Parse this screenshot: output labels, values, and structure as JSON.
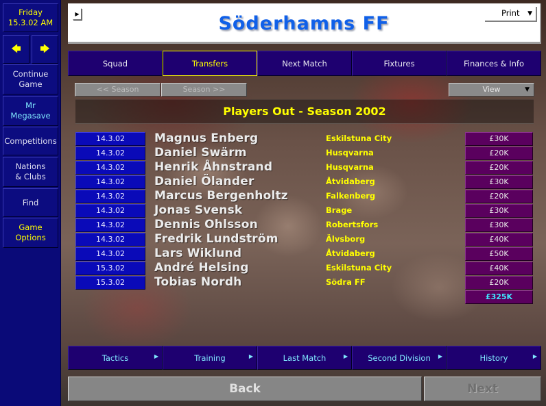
{
  "sidebar": {
    "date_day": "Friday",
    "date_value": "15.3.02 AM",
    "prev_icon": "left-arrow-icon",
    "next_icon": "right-arrow-icon",
    "items": [
      {
        "label": "Continue Game",
        "line1": "Continue",
        "line2": "Game"
      },
      {
        "label": "Mr Megasave",
        "line1": "Mr",
        "line2": "Megasave"
      },
      {
        "label": "Competitions",
        "line1": "Competitions",
        "line2": ""
      },
      {
        "label": "Nations & Clubs",
        "line1": "Nations",
        "line2": "& Clubs"
      },
      {
        "label": "Find",
        "line1": "Find",
        "line2": ""
      },
      {
        "label": "Game Options",
        "line1": "Game",
        "line2": "Options"
      }
    ]
  },
  "header": {
    "club_name": "Söderhamns FF",
    "print_label": "Print",
    "toggle_glyph": "▶",
    "caret_glyph": "▼"
  },
  "tabs": [
    {
      "label": "Squad",
      "active": false
    },
    {
      "label": "Transfers",
      "active": true
    },
    {
      "label": "Next Match",
      "active": false
    },
    {
      "label": "Fixtures",
      "active": false
    },
    {
      "label": "Finances & Info",
      "active": false
    }
  ],
  "controls": {
    "prev_season": "<< Season",
    "next_season": "Season >>",
    "view_label": "View"
  },
  "page_title": "Players Out - Season 2002",
  "transfers": [
    {
      "date": "14.3.02",
      "player": "Magnus Enberg",
      "club": "Eskilstuna City",
      "fee": "£30K"
    },
    {
      "date": "14.3.02",
      "player": "Daniel Swärm",
      "club": "Husqvarna",
      "fee": "£20K"
    },
    {
      "date": "14.3.02",
      "player": "Henrik Åhnstrand",
      "club": "Husqvarna",
      "fee": "£20K"
    },
    {
      "date": "14.3.02",
      "player": "Daniel Ölander",
      "club": "Åtvidaberg",
      "fee": "£30K"
    },
    {
      "date": "14.3.02",
      "player": "Marcus Bergenholtz",
      "club": "Falkenberg",
      "fee": "£20K"
    },
    {
      "date": "14.3.02",
      "player": "Jonas Svensk",
      "club": "Brage",
      "fee": "£30K"
    },
    {
      "date": "14.3.02",
      "player": "Dennis Ohlsson",
      "club": "Robertsfors",
      "fee": "£30K"
    },
    {
      "date": "14.3.02",
      "player": "Fredrik Lundström",
      "club": "Älvsborg",
      "fee": "£40K"
    },
    {
      "date": "14.3.02",
      "player": "Lars Wiklund",
      "club": "Åtvidaberg",
      "fee": "£50K"
    },
    {
      "date": "15.3.02",
      "player": "André Helsing",
      "club": "Eskilstuna City",
      "fee": "£40K"
    },
    {
      "date": "15.3.02",
      "player": "Tobias Nordh",
      "club": "Södra FF",
      "fee": "£20K"
    }
  ],
  "total_fee": "£325K",
  "bottom_tabs": [
    {
      "label": "Tactics"
    },
    {
      "label": "Training"
    },
    {
      "label": "Last Match"
    },
    {
      "label": "Second Division"
    },
    {
      "label": "History"
    }
  ],
  "bottom_tab_arrow": "▶",
  "back_label": "Back",
  "next_label": "Next",
  "colors": {
    "sidebar_bg": "#0a0a78",
    "tab_bg": "#1e0070",
    "highlight_yellow": "#ffff00",
    "title_blue": "#1060e8",
    "date_cell_bg": "#0a0ab8",
    "fee_cell_bg": "#5a005e",
    "total_cyan": "#40e8ff"
  }
}
